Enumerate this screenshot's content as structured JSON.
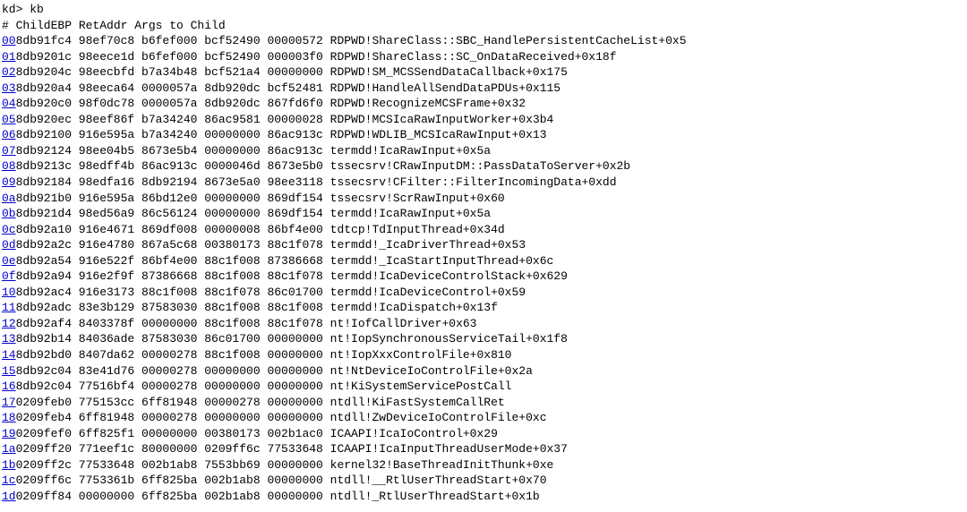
{
  "prompt": "kd> kb",
  "header": " # ChildEBP RetAddr  Args to Child",
  "frames": [
    {
      "num": "00",
      "childebp": "8db91fc4",
      "retaddr": "98ef70c8",
      "a0": "b6fef000",
      "a1": "bcf52490",
      "a2": "00000572",
      "func": "RDPWD!ShareClass::SBC_HandlePersistentCacheList+0x5"
    },
    {
      "num": "01",
      "childebp": "8db9201c",
      "retaddr": "98eece1d",
      "a0": "b6fef000",
      "a1": "bcf52490",
      "a2": "000003f0",
      "func": "RDPWD!ShareClass::SC_OnDataReceived+0x18f"
    },
    {
      "num": "02",
      "childebp": "8db9204c",
      "retaddr": "98eecbfd",
      "a0": "b7a34b48",
      "a1": "bcf521a4",
      "a2": "00000000",
      "func": "RDPWD!SM_MCSSendDataCallback+0x175"
    },
    {
      "num": "03",
      "childebp": "8db920a4",
      "retaddr": "98eeca64",
      "a0": "0000057a",
      "a1": "8db920dc",
      "a2": "bcf52481",
      "func": "RDPWD!HandleAllSendDataPDUs+0x115"
    },
    {
      "num": "04",
      "childebp": "8db920c0",
      "retaddr": "98f0dc78",
      "a0": "0000057a",
      "a1": "8db920dc",
      "a2": "867fd6f0",
      "func": "RDPWD!RecognizeMCSFrame+0x32"
    },
    {
      "num": "05",
      "childebp": "8db920ec",
      "retaddr": "98eef86f",
      "a0": "b7a34240",
      "a1": "86ac9581",
      "a2": "00000028",
      "func": "RDPWD!MCSIcaRawInputWorker+0x3b4"
    },
    {
      "num": "06",
      "childebp": "8db92100",
      "retaddr": "916e595a",
      "a0": "b7a34240",
      "a1": "00000000",
      "a2": "86ac913c",
      "func": "RDPWD!WDLIB_MCSIcaRawInput+0x13"
    },
    {
      "num": "07",
      "childebp": "8db92124",
      "retaddr": "98ee04b5",
      "a0": "8673e5b4",
      "a1": "00000000",
      "a2": "86ac913c",
      "func": "termdd!IcaRawInput+0x5a"
    },
    {
      "num": "08",
      "childebp": "8db9213c",
      "retaddr": "98edff4b",
      "a0": "86ac913c",
      "a1": "0000046d",
      "a2": "8673e5b0",
      "func": "tssecsrv!CRawInputDM::PassDataToServer+0x2b"
    },
    {
      "num": "09",
      "childebp": "8db92184",
      "retaddr": "98edfa16",
      "a0": "8db92194",
      "a1": "8673e5a0",
      "a2": "98ee3118",
      "func": "tssecsrv!CFilter::FilterIncomingData+0xdd"
    },
    {
      "num": "0a",
      "childebp": "8db921b0",
      "retaddr": "916e595a",
      "a0": "86bd12e0",
      "a1": "00000000",
      "a2": "869df154",
      "func": "tssecsrv!ScrRawInput+0x60"
    },
    {
      "num": "0b",
      "childebp": "8db921d4",
      "retaddr": "98ed56a9",
      "a0": "86c56124",
      "a1": "00000000",
      "a2": "869df154",
      "func": "termdd!IcaRawInput+0x5a"
    },
    {
      "num": "0c",
      "childebp": "8db92a10",
      "retaddr": "916e4671",
      "a0": "869df008",
      "a1": "00000008",
      "a2": "86bf4e00",
      "func": "tdtcp!TdInputThread+0x34d"
    },
    {
      "num": "0d",
      "childebp": "8db92a2c",
      "retaddr": "916e4780",
      "a0": "867a5c68",
      "a1": "00380173",
      "a2": "88c1f078",
      "func": "termdd!_IcaDriverThread+0x53"
    },
    {
      "num": "0e",
      "childebp": "8db92a54",
      "retaddr": "916e522f",
      "a0": "86bf4e00",
      "a1": "88c1f008",
      "a2": "87386668",
      "func": "termdd!_IcaStartInputThread+0x6c"
    },
    {
      "num": "0f",
      "childebp": "8db92a94",
      "retaddr": "916e2f9f",
      "a0": "87386668",
      "a1": "88c1f008",
      "a2": "88c1f078",
      "func": "termdd!IcaDeviceControlStack+0x629"
    },
    {
      "num": "10",
      "childebp": "8db92ac4",
      "retaddr": "916e3173",
      "a0": "88c1f008",
      "a1": "88c1f078",
      "a2": "86c01700",
      "func": "termdd!IcaDeviceControl+0x59"
    },
    {
      "num": "11",
      "childebp": "8db92adc",
      "retaddr": "83e3b129",
      "a0": "87583030",
      "a1": "88c1f008",
      "a2": "88c1f008",
      "func": "termdd!IcaDispatch+0x13f"
    },
    {
      "num": "12",
      "childebp": "8db92af4",
      "retaddr": "8403378f",
      "a0": "00000000",
      "a1": "88c1f008",
      "a2": "88c1f078",
      "func": "nt!IofCallDriver+0x63"
    },
    {
      "num": "13",
      "childebp": "8db92b14",
      "retaddr": "84036ade",
      "a0": "87583030",
      "a1": "86c01700",
      "a2": "00000000",
      "func": "nt!IopSynchronousServiceTail+0x1f8"
    },
    {
      "num": "14",
      "childebp": "8db92bd0",
      "retaddr": "8407da62",
      "a0": "00000278",
      "a1": "88c1f008",
      "a2": "00000000",
      "func": "nt!IopXxxControlFile+0x810"
    },
    {
      "num": "15",
      "childebp": "8db92c04",
      "retaddr": "83e41d76",
      "a0": "00000278",
      "a1": "00000000",
      "a2": "00000000",
      "func": "nt!NtDeviceIoControlFile+0x2a"
    },
    {
      "num": "16",
      "childebp": "8db92c04",
      "retaddr": "77516bf4",
      "a0": "00000278",
      "a1": "00000000",
      "a2": "00000000",
      "func": "nt!KiSystemServicePostCall"
    },
    {
      "num": "17",
      "childebp": "0209feb0",
      "retaddr": "775153cc",
      "a0": "6ff81948",
      "a1": "00000278",
      "a2": "00000000",
      "func": "ntdll!KiFastSystemCallRet"
    },
    {
      "num": "18",
      "childebp": "0209feb4",
      "retaddr": "6ff81948",
      "a0": "00000278",
      "a1": "00000000",
      "a2": "00000000",
      "func": "ntdll!ZwDeviceIoControlFile+0xc"
    },
    {
      "num": "19",
      "childebp": "0209fef0",
      "retaddr": "6ff825f1",
      "a0": "00000000",
      "a1": "00380173",
      "a2": "002b1ac0",
      "func": "ICAAPI!IcaIoControl+0x29"
    },
    {
      "num": "1a",
      "childebp": "0209ff20",
      "retaddr": "771eef1c",
      "a0": "80000000",
      "a1": "0209ff6c",
      "a2": "77533648",
      "func": "ICAAPI!IcaInputThreadUserMode+0x37"
    },
    {
      "num": "1b",
      "childebp": "0209ff2c",
      "retaddr": "77533648",
      "a0": "002b1ab8",
      "a1": "7553bb69",
      "a2": "00000000",
      "func": "kernel32!BaseThreadInitThunk+0xe"
    },
    {
      "num": "1c",
      "childebp": "0209ff6c",
      "retaddr": "7753361b",
      "a0": "6ff825ba",
      "a1": "002b1ab8",
      "a2": "00000000",
      "func": "ntdll!__RtlUserThreadStart+0x70"
    },
    {
      "num": "1d",
      "childebp": "0209ff84",
      "retaddr": "00000000",
      "a0": "6ff825ba",
      "a1": "002b1ab8",
      "a2": "00000000",
      "func": "ntdll!_RtlUserThreadStart+0x1b"
    }
  ]
}
